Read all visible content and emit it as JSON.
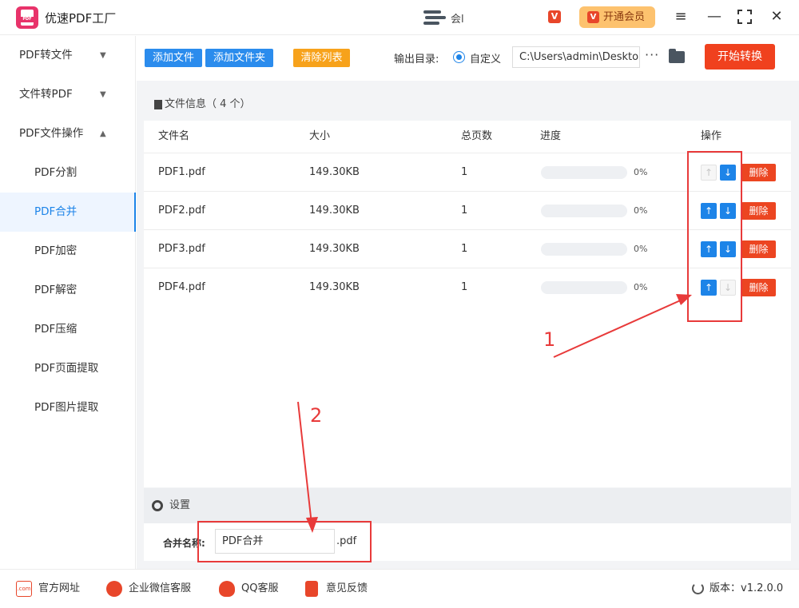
{
  "app": {
    "title": "优速PDF工厂",
    "logo_text": "PDF"
  },
  "user": {
    "text": "会l",
    "v_badge": "V"
  },
  "vip": {
    "label": "开通会员",
    "icon": "V"
  },
  "window_controls": [
    "menu-icon",
    "minimize-icon",
    "maximize-icon",
    "close-icon"
  ],
  "sidebar": {
    "items": [
      {
        "label": "PDF转文件",
        "chevron": "⌄"
      },
      {
        "label": "文件转PDF",
        "chevron": "⌄"
      },
      {
        "label": "PDF文件操作",
        "chevron": "⌃"
      },
      {
        "label": "PDF分割"
      },
      {
        "label": "PDF合并",
        "active": true
      },
      {
        "label": "PDF加密"
      },
      {
        "label": "PDF解密"
      },
      {
        "label": "PDF压缩"
      },
      {
        "label": "PDF页面提取"
      },
      {
        "label": "PDF图片提取"
      }
    ]
  },
  "toolbar": {
    "add_file": "添加文件",
    "add_folder": "添加文件夹",
    "clear_list": "清除列表",
    "output_label": "输出目录:",
    "radio_label": "自定义",
    "path_value": "C:\\Users\\admin\\Deskto",
    "more": "···",
    "start": "开始转换"
  },
  "file_info": {
    "header": "文件信息（ 4 个）",
    "columns": [
      "文件名",
      "大小",
      "总页数",
      "进度",
      "操作"
    ],
    "rows": [
      {
        "name": "PDF1.pdf",
        "size": "149.30KB",
        "pages": "1",
        "progress": 0,
        "progress_label": "0%",
        "up_enabled": false,
        "down_enabled": true,
        "delete": "删除"
      },
      {
        "name": "PDF2.pdf",
        "size": "149.30KB",
        "pages": "1",
        "progress": 0,
        "progress_label": "0%",
        "up_enabled": true,
        "down_enabled": true,
        "delete": "删除"
      },
      {
        "name": "PDF3.pdf",
        "size": "149.30KB",
        "pages": "1",
        "progress": 0,
        "progress_label": "0%",
        "up_enabled": true,
        "down_enabled": true,
        "delete": "删除"
      },
      {
        "name": "PDF4.pdf",
        "size": "149.30KB",
        "pages": "1",
        "progress": 0,
        "progress_label": "0%",
        "up_enabled": true,
        "down_enabled": false,
        "delete": "删除"
      }
    ]
  },
  "settings": {
    "header": "设置",
    "name_label": "合并名称:",
    "name_value": "PDF合并",
    "name_suffix": ".pdf"
  },
  "footer": {
    "website": "官方网址",
    "website_icon": ".com",
    "wechat": "企业微信客服",
    "qq": "QQ客服",
    "feedback": "意见反馈",
    "version": "版本：v1.2.0.0"
  },
  "annotations": {
    "label_1": "1",
    "label_2": "2"
  },
  "colors": {
    "accent": "#1d84e8",
    "danger": "#ec4521",
    "annotation": "#e83a3a",
    "start_button": "#f0411e"
  }
}
